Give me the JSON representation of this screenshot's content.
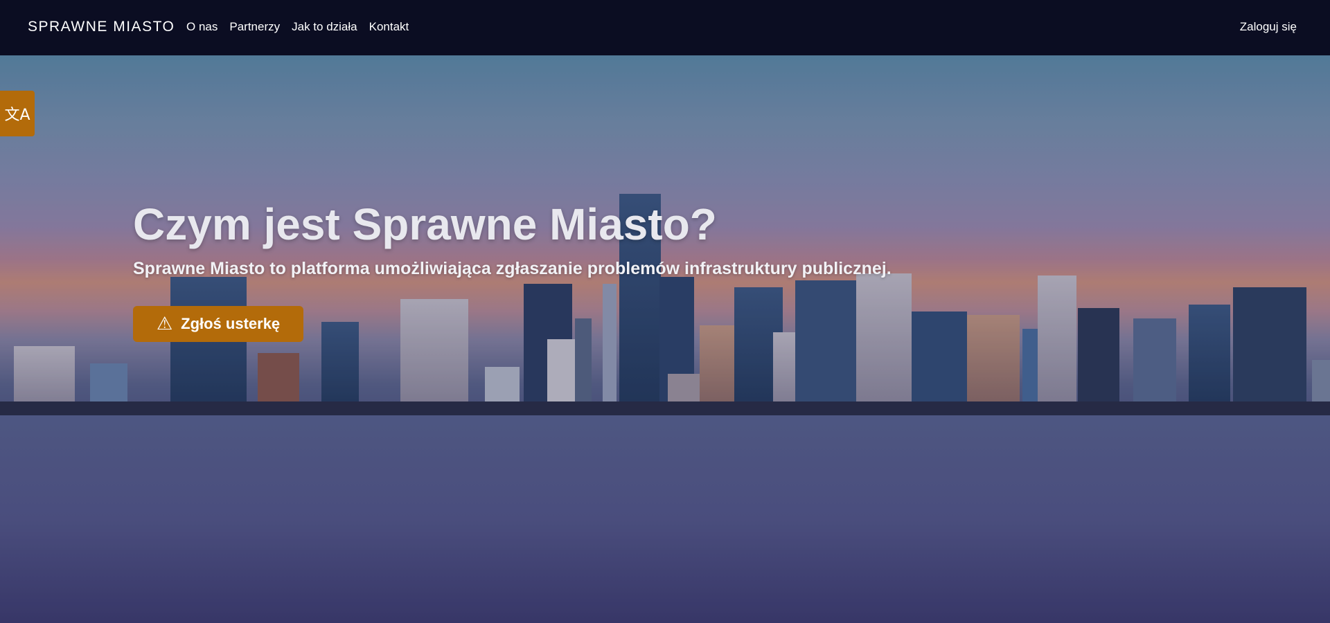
{
  "navbar": {
    "brand": "SPRAWNE MIASTO",
    "links": [
      "O nas",
      "Partnerzy",
      "Jak to działa",
      "Kontakt"
    ],
    "login": "Zaloguj się"
  },
  "language_button": {
    "icon": "translate-icon",
    "glyph": "文A"
  },
  "hero": {
    "title": "Czym jest Sprawne Miasto?",
    "subtitle": "Sprawne Miasto to platforma umożliwiająca zgłaszanie problemów infrastruktury publicznej.",
    "button_label": "Zgłoś usterkę",
    "button_icon": "warning-icon"
  },
  "colors": {
    "navbar_bg": "#0b0d22",
    "accent": "#b36b0a",
    "text": "#ffffff"
  }
}
